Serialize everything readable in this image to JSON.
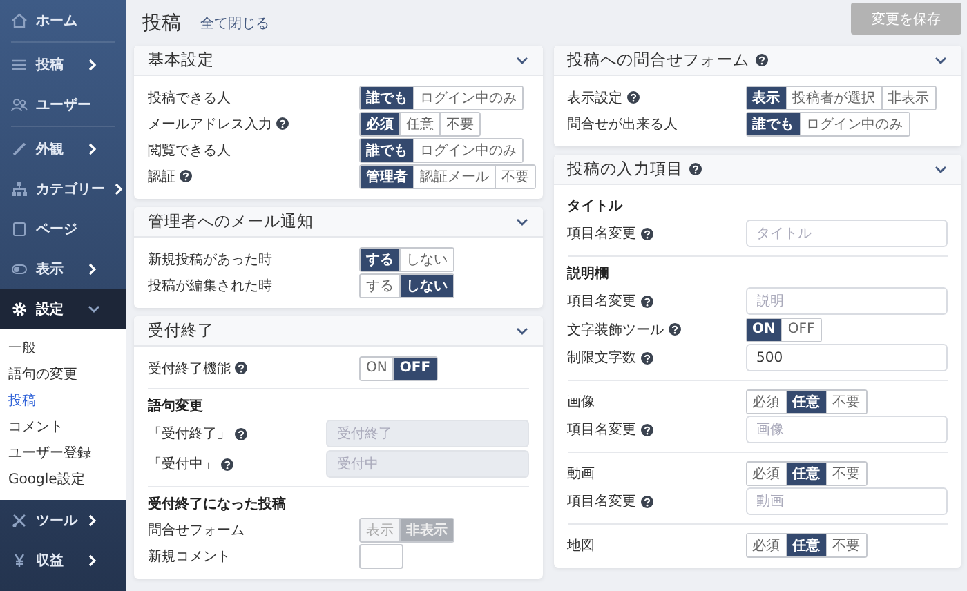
{
  "sidebar": {
    "items": [
      {
        "label": "ホーム",
        "selected": false,
        "divider_after": true
      },
      {
        "label": "投稿",
        "selected": false,
        "expanded": false
      },
      {
        "label": "ユーザー",
        "selected": false,
        "divider_after": true
      },
      {
        "label": "外観",
        "selected": false,
        "expanded": false
      },
      {
        "label": "カテゴリー",
        "selected": false,
        "expanded": false
      },
      {
        "label": "ページ",
        "selected": false
      },
      {
        "label": "表示",
        "selected": false,
        "expanded": false
      },
      {
        "label": "設定",
        "selected": true,
        "expanded": true,
        "children": [
          {
            "label": "一般",
            "selected": false
          },
          {
            "label": "語句の変更",
            "selected": false
          },
          {
            "label": "投稿",
            "selected": true
          },
          {
            "label": "コメント",
            "selected": false
          },
          {
            "label": "ユーザー登録",
            "selected": false
          },
          {
            "label": "Google設定",
            "selected": false
          }
        ]
      },
      {
        "label": "ツール",
        "selected": false,
        "expanded": false
      },
      {
        "label": "収益",
        "selected": false,
        "expanded": false
      }
    ]
  },
  "header": {
    "title": "投稿",
    "link": "全て閉じる",
    "save_button": {
      "label": "変更を保存",
      "disabled": true
    }
  },
  "columns": [
    {
      "cards": [
        {
          "title": "基本設定",
          "expanded": true,
          "rows": [
            {
              "kind": "toggle",
              "label": "投稿できる人",
              "options": [
                {
                  "label": "誰でも",
                  "selected": true
                },
                {
                  "label": "ログイン中のみ",
                  "selected": false
                }
              ]
            },
            {
              "kind": "toggle",
              "label": "メールアドレス入力",
              "help": true,
              "options": [
                {
                  "label": "必須",
                  "selected": true
                },
                {
                  "label": "任意",
                  "selected": false
                },
                {
                  "label": "不要",
                  "selected": false
                }
              ]
            },
            {
              "kind": "toggle",
              "label": "閲覧できる人",
              "options": [
                {
                  "label": "誰でも",
                  "selected": true
                },
                {
                  "label": "ログイン中のみ",
                  "selected": false
                }
              ]
            },
            {
              "kind": "toggle",
              "label": "認証",
              "help": true,
              "options": [
                {
                  "label": "管理者",
                  "selected": true
                },
                {
                  "label": "認証メール",
                  "selected": false
                },
                {
                  "label": "不要",
                  "selected": false
                }
              ]
            }
          ]
        },
        {
          "title": "管理者へのメール通知",
          "expanded": true,
          "rows": [
            {
              "kind": "toggle",
              "label": "新規投稿があった時",
              "options": [
                {
                  "label": "する",
                  "selected": true
                },
                {
                  "label": "しない",
                  "selected": false
                }
              ]
            },
            {
              "kind": "toggle",
              "label": "投稿が編集された時",
              "options": [
                {
                  "label": "する",
                  "selected": false
                },
                {
                  "label": "しない",
                  "selected": true
                }
              ]
            }
          ]
        },
        {
          "title": "受付終了",
          "expanded": true,
          "rows": [
            {
              "kind": "toggle",
              "label": "受付終了機能",
              "help": true,
              "options": [
                {
                  "label": "ON",
                  "selected": false
                },
                {
                  "label": "OFF",
                  "selected": true
                }
              ]
            },
            {
              "kind": "divider"
            },
            {
              "kind": "heading",
              "label": "語句変更"
            },
            {
              "kind": "field",
              "label": "「受付終了」",
              "help": true,
              "disabled": true,
              "placeholder": "受付終了"
            },
            {
              "kind": "field",
              "label": "「受付中」",
              "help": true,
              "disabled": true,
              "placeholder": "受付中"
            },
            {
              "kind": "divider"
            },
            {
              "kind": "heading",
              "label": "受付終了になった投稿"
            },
            {
              "kind": "toggle",
              "label": "問合せフォーム",
              "disabled": true,
              "options": [
                {
                  "label": "表示",
                  "selected": false
                },
                {
                  "label": "非表示",
                  "selected": true
                }
              ]
            },
            {
              "kind": "toggle",
              "label": "新規コメント",
              "disabled": true
            }
          ]
        }
      ]
    },
    {
      "cards": [
        {
          "title": "投稿への問合せフォーム",
          "help": true,
          "expanded": true,
          "rows": [
            {
              "kind": "toggle",
              "label": "表示設定",
              "help": true,
              "options": [
                {
                  "label": "表示",
                  "selected": true
                },
                {
                  "label": "投稿者が選択",
                  "selected": false
                },
                {
                  "label": "非表示",
                  "selected": false
                }
              ]
            },
            {
              "kind": "toggle",
              "label": "問合せが出来る人",
              "options": [
                {
                  "label": "誰でも",
                  "selected": true
                },
                {
                  "label": "ログイン中のみ",
                  "selected": false
                }
              ]
            }
          ]
        },
        {
          "title": "投稿の入力項目",
          "help": true,
          "expanded": true,
          "rows": [
            {
              "kind": "heading",
              "label": "タイトル"
            },
            {
              "kind": "field",
              "label": "項目名変更",
              "help": true,
              "placeholder": "タイトル"
            },
            {
              "kind": "divider"
            },
            {
              "kind": "heading",
              "label": "説明欄"
            },
            {
              "kind": "field",
              "label": "項目名変更",
              "help": true,
              "placeholder": "説明"
            },
            {
              "kind": "toggle",
              "label": "文字装飾ツール",
              "help": true,
              "options": [
                {
                  "label": "ON",
                  "selected": true
                },
                {
                  "label": "OFF",
                  "selected": false
                }
              ]
            },
            {
              "kind": "field",
              "label": "制限文字数",
              "help": true,
              "value": "500"
            },
            {
              "kind": "divider"
            },
            {
              "kind": "toggle",
              "label": "画像",
              "options": [
                {
                  "label": "必須",
                  "selected": false
                },
                {
                  "label": "任意",
                  "selected": true
                },
                {
                  "label": "不要",
                  "selected": false
                }
              ]
            },
            {
              "kind": "field",
              "label": "項目名変更",
              "help": true,
              "placeholder": "画像"
            },
            {
              "kind": "divider"
            },
            {
              "kind": "toggle",
              "label": "動画",
              "options": [
                {
                  "label": "必須",
                  "selected": false
                },
                {
                  "label": "任意",
                  "selected": true
                },
                {
                  "label": "不要",
                  "selected": false
                }
              ]
            },
            {
              "kind": "field",
              "label": "項目名変更",
              "help": true,
              "placeholder": "動画"
            },
            {
              "kind": "divider"
            },
            {
              "kind": "toggle",
              "label": "地図",
              "options": [
                {
                  "label": "必須",
                  "selected": false
                },
                {
                  "label": "任意",
                  "selected": true
                },
                {
                  "label": "不要",
                  "selected": false
                }
              ]
            }
          ]
        }
      ]
    }
  ]
}
